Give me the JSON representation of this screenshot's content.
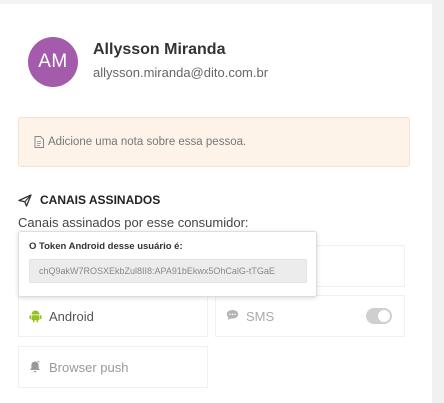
{
  "profile": {
    "initials": "AM",
    "name": "Allysson Miranda",
    "email": "allysson.miranda@dito.com.br",
    "avatar_color": "#a55bab"
  },
  "note": {
    "placeholder": "Adicione uma nota sobre essa pessoa.",
    "icon": "document-icon",
    "background": "#fdf3e9"
  },
  "channels": {
    "title": "CANAIS ASSINADOS",
    "title_icon": "send-icon",
    "subtitle": "Canais assinados por esse consumidor:",
    "items": [
      {
        "label": "Android",
        "icon": "android-icon",
        "icon_color": "#97c024"
      },
      {
        "label": "SMS",
        "icon": "chat-icon",
        "toggle": "off"
      },
      {
        "label": "Browser push",
        "icon": "bell-icon"
      }
    ]
  },
  "popover": {
    "label": "O Token Android desse usuário é:",
    "token": "chQ9akW7ROSXEkbZul8II8:APA91bEkwx5OhCalG-tTGaE"
  }
}
